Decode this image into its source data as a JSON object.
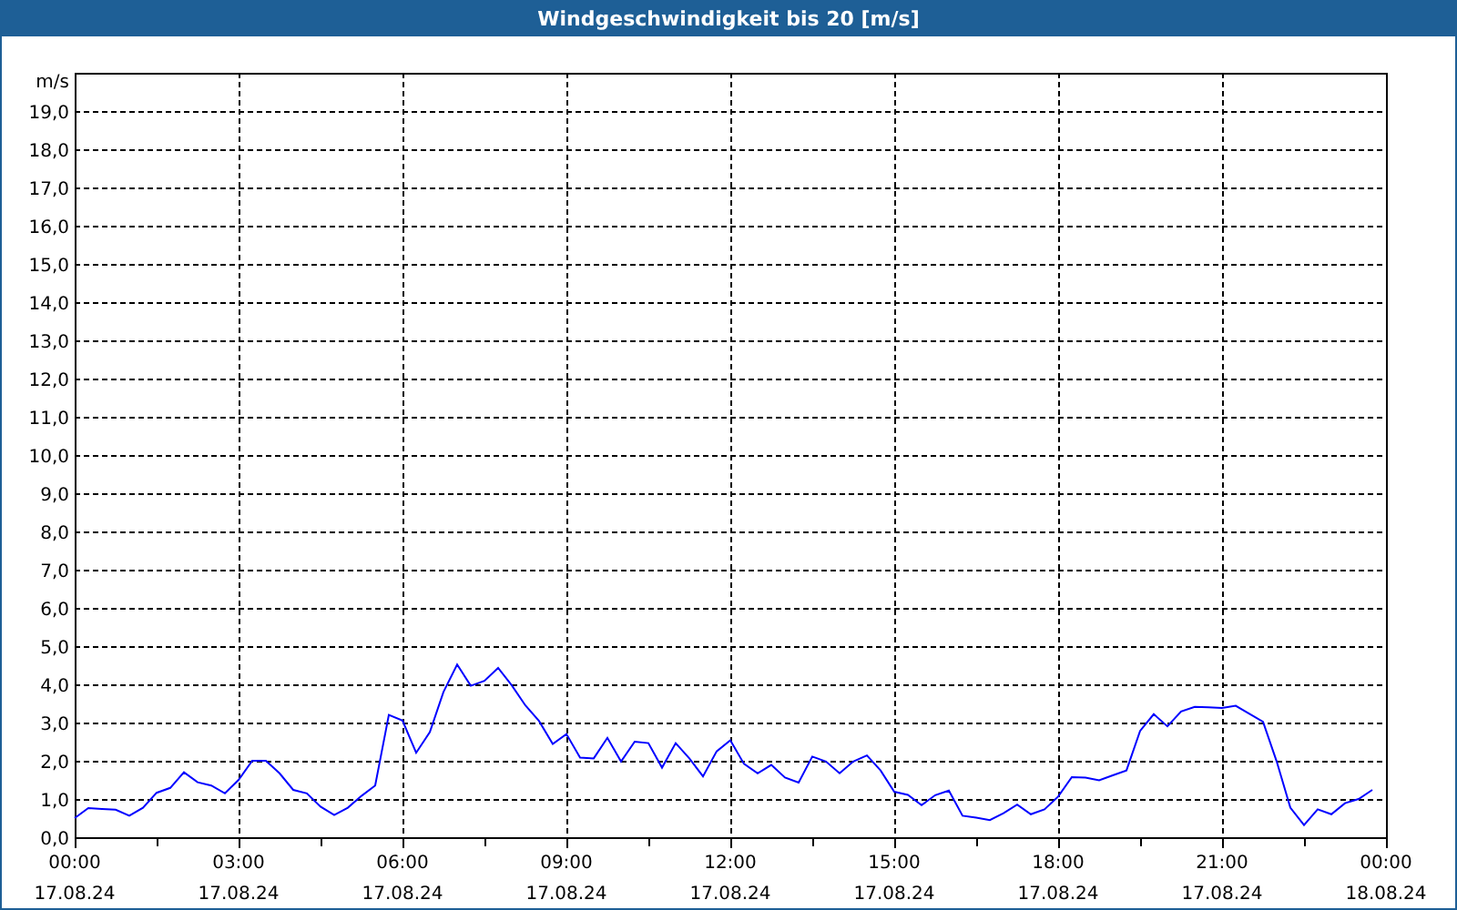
{
  "chart": {
    "chart_data": {
      "type": "line",
      "grid": true,
      "title": "Windgeschwindigkeit bis 20 [m/s]",
      "ylabel": "m/s",
      "ylim": [
        0,
        20
      ],
      "categories": [
        "00:00\n17.08.24",
        null,
        null,
        null,
        null,
        null,
        null,
        null,
        null,
        null,
        null,
        null,
        "03:00\n17.08.24",
        null,
        null,
        null,
        null,
        null,
        null,
        null,
        null,
        null,
        null,
        null,
        "06:00\n17.08.24",
        null,
        null,
        null,
        null,
        null,
        null,
        null,
        null,
        null,
        null,
        null,
        "09:00\n17.08.24",
        null,
        null,
        null,
        null,
        null,
        null,
        null,
        null,
        null,
        null,
        null,
        "12:00\n17.08.24",
        null,
        null,
        null,
        null,
        null,
        null,
        null,
        null,
        null,
        null,
        null,
        "15:00\n17.08.24",
        null,
        null,
        null,
        null,
        null,
        null,
        null,
        null,
        null,
        null,
        null,
        "18:00\n17.08.24",
        null,
        null,
        null,
        null,
        null,
        null,
        null,
        null,
        null,
        null,
        null,
        "21:00\n17.08.24",
        null,
        null,
        null,
        null,
        null,
        null,
        null,
        null,
        null,
        null,
        null,
        "00:00\n18.08.24"
      ],
      "yticks": [
        {
          "value": 0,
          "label": "0,0"
        },
        {
          "value": 1,
          "label": "1,0"
        },
        {
          "value": 2,
          "label": "2,0"
        },
        {
          "value": 3,
          "label": "3,0"
        },
        {
          "value": 4,
          "label": "4,0"
        },
        {
          "value": 5,
          "label": "5,0"
        },
        {
          "value": 6,
          "label": "6,0"
        },
        {
          "value": 7,
          "label": "7,0"
        },
        {
          "value": 8,
          "label": "8,0"
        },
        {
          "value": 9,
          "label": "9,0"
        },
        {
          "value": 10,
          "label": "10,0"
        },
        {
          "value": 11,
          "label": "11,0"
        },
        {
          "value": 12,
          "label": "12,0"
        },
        {
          "value": 13,
          "label": "13,0"
        },
        {
          "value": 14,
          "label": "14,0"
        },
        {
          "value": 15,
          "label": "15,0"
        },
        {
          "value": 16,
          "label": "16,0"
        },
        {
          "value": 17,
          "label": "17,0"
        },
        {
          "value": 18,
          "label": "18,0"
        },
        {
          "value": 19,
          "label": "19,0"
        }
      ],
      "series": [
        {
          "color": "#0000ff",
          "values": [
            0.5,
            0.76,
            0.74,
            0.72,
            0.56,
            0.77,
            1.16,
            1.29,
            1.7,
            1.44,
            1.35,
            1.15,
            1.5,
            2.0,
            2.0,
            1.67,
            1.24,
            1.15,
            0.8,
            0.58,
            0.77,
            1.08,
            1.35,
            3.2,
            3.05,
            2.21,
            2.75,
            3.8,
            4.52,
            3.96,
            4.09,
            4.43,
            3.97,
            3.45,
            3.04,
            2.44,
            2.7,
            2.08,
            2.06,
            2.6,
            1.98,
            2.5,
            2.46,
            1.82,
            2.46,
            2.06,
            1.59,
            2.25,
            2.54,
            1.92,
            1.67,
            1.89,
            1.56,
            1.43,
            2.11,
            1.98,
            1.67,
            1.98,
            2.14,
            1.75,
            1.19,
            1.11,
            0.84,
            1.1,
            1.22,
            0.56,
            0.51,
            0.45,
            0.63,
            0.85,
            0.6,
            0.73,
            1.06,
            1.57,
            1.56,
            1.49,
            1.62,
            1.75,
            2.78,
            3.22,
            2.9,
            3.29,
            3.41,
            3.4,
            3.38,
            3.44,
            3.23,
            3.02,
            1.98,
            0.77,
            0.32,
            0.73,
            0.6,
            0.89,
            1.0,
            1.24,
            null
          ]
        }
      ]
    }
  }
}
